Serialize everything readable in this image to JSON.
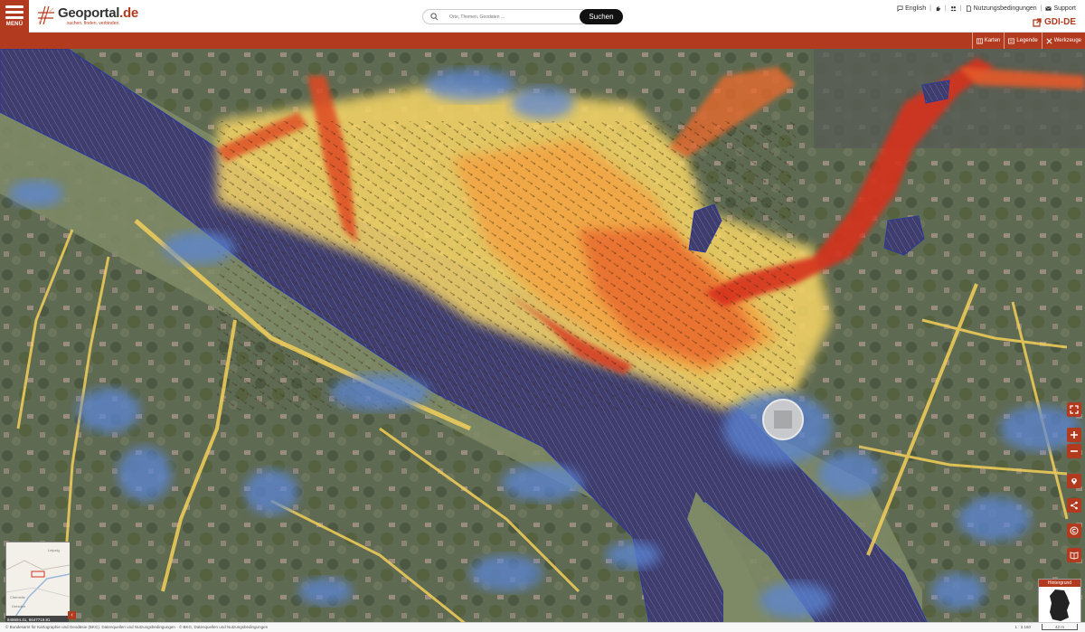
{
  "header": {
    "menu_label": "MENÜ",
    "logo_name": "Geoportal",
    "logo_tld": ".de",
    "logo_tagline": "suchen. finden. verbinden.",
    "search_placeholder": "Orte, Themen, Geodaten ...",
    "search_button": "Suchen",
    "links": {
      "english": "English",
      "terms": "Nutzungsbedingungen",
      "support": "Support"
    },
    "gdi_de": "GDI-DE"
  },
  "toolbar": {
    "karten": "Karten",
    "legende": "Legende",
    "werkzeuge": "Werkzeuge"
  },
  "map": {
    "coordinates": "848694.41, 6647719.81",
    "hintergrund_label": "Hintergrund",
    "overview_labels": [
      "Leipzig",
      "Chemnitz",
      "Dresden"
    ],
    "colors": {
      "accent": "#b23a1f",
      "river": "#3e3d6e",
      "flow_high": "#d7301f",
      "flow_mid": "#f08c3a",
      "flow_low": "#f8d766",
      "depth_low": "#5b86d6"
    }
  },
  "footer": {
    "copyright": "© Bundesamt für Kartographie und Geodäsie (BKG). Datenquellen und Nutzungsbedingungen · © BKG, Datenquellen und Nutzungsbedingungen",
    "scale": "1 : 3.160",
    "scale_bar": "42 m"
  },
  "icons": [
    "menu-icon",
    "search-icon",
    "chat-icon",
    "people-icon",
    "document-icon",
    "mail-icon",
    "external-link-icon",
    "map-icon",
    "legend-icon",
    "tools-icon",
    "fullscreen-icon",
    "zoom-in-icon",
    "zoom-out-icon",
    "location-icon",
    "share-icon",
    "copyright-icon",
    "book-icon"
  ]
}
